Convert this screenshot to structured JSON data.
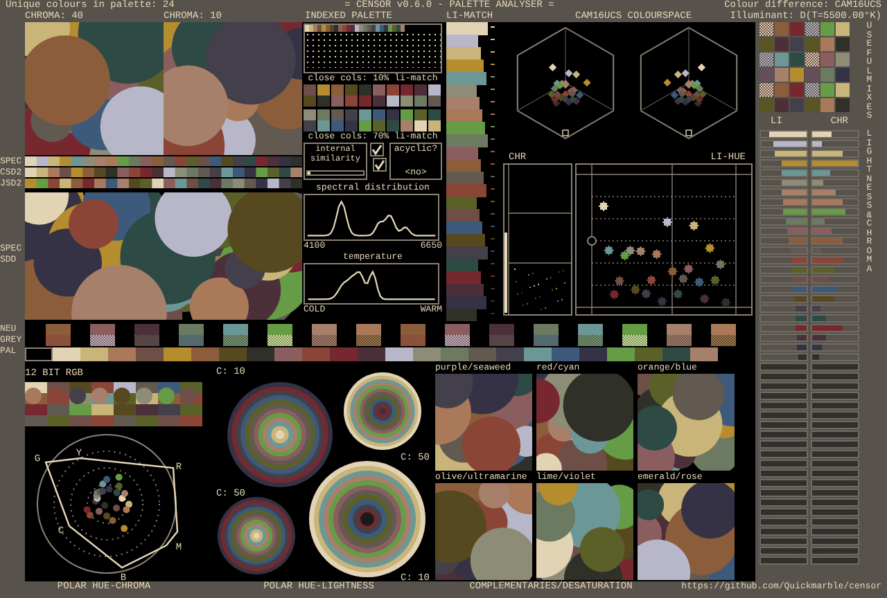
{
  "header": {
    "unique_colours": "Unique colours in palette: 24",
    "title": "= CENSOR v0.6.0 - PALETTE ANALYSER =",
    "colour_difference": "Colour difference: CAM16UCS",
    "illuminant": "Illuminant: D(T=5500.00°K)"
  },
  "palette": [
    {
      "color": "#e2d3b5"
    },
    {
      "color": "#c9b479"
    },
    {
      "color": "#a9795a"
    },
    {
      "color": "#6d4f47"
    },
    {
      "color": "#b58d2e"
    },
    {
      "color": "#8b5d3b"
    },
    {
      "color": "#57491f"
    },
    {
      "color": "#2f3129"
    },
    {
      "color": "#8a5e5f"
    },
    {
      "color": "#8b4537"
    },
    {
      "color": "#77282f"
    },
    {
      "color": "#4b3039"
    },
    {
      "color": "#b8b7c9"
    },
    {
      "color": "#8d8c77"
    },
    {
      "color": "#6b7a61"
    },
    {
      "color": "#625950"
    },
    {
      "color": "#433f4b"
    },
    {
      "color": "#6c9797"
    },
    {
      "color": "#3d5a7a"
    },
    {
      "color": "#343244"
    },
    {
      "color": "#659c45"
    },
    {
      "color": "#5b6029"
    },
    {
      "color": "#2e4a45"
    },
    {
      "color": "#a6806a"
    }
  ],
  "chroma_maps": [
    {
      "label": "CHROMA: 40"
    },
    {
      "label": "CHROMA: 10"
    }
  ],
  "row_labels": {
    "spec_bars": [
      "SPEC",
      "CSD2",
      "JSD2"
    ],
    "spec_map": [
      "SPEC",
      "SDD"
    ],
    "neutral": [
      "NEU",
      "GREY"
    ],
    "pal": "PAL"
  },
  "indexed_palette": {
    "title": "INDEXED PALETTE",
    "close_10": "close cols: 10% li-match",
    "close_70": "close cols: 70% li-match",
    "internal_similarity": {
      "label": "internal similarity",
      "checked": true,
      "level": 0.06
    },
    "acyclic": {
      "label": "acyclic?",
      "checked": true,
      "value": "<no>"
    },
    "spectral": {
      "title": "spectral distribution",
      "min": "4100",
      "max": "6650"
    },
    "temperature": {
      "title": "temperature",
      "min": "COLD",
      "max": "WARM"
    }
  },
  "li_match": {
    "title": "LI-MATCH"
  },
  "colourspace": {
    "title": "CAM16UCS COLOURSPACE",
    "chr": "CHR",
    "li_hue": "LI-HUE"
  },
  "right_panel": {
    "useful_mixes": "USEFUL MIXES",
    "li": "LI",
    "chr": "CHR",
    "lightness_chroma": "LIGHTNESS & CHROMA"
  },
  "rgb12": {
    "title": "12 BIT RGB"
  },
  "polar_chroma": {
    "hue_labels": [
      "G",
      "Y",
      "R",
      "C",
      "M",
      "B"
    ],
    "caption": "POLAR HUE-CHROMA"
  },
  "polar_lightness": {
    "discs": [
      {
        "label": "C: 10"
      },
      {
        "label": "C: 50"
      },
      {
        "label": "C: 50"
      },
      {
        "label": "C: 10"
      }
    ],
    "caption": "POLAR HUE-LIGHTNESS"
  },
  "complementaries": {
    "panels": [
      {
        "label": "purple/seaweed"
      },
      {
        "label": "red/cyan"
      },
      {
        "label": "orange/blue"
      },
      {
        "label": "olive/ultramarine"
      },
      {
        "label": "lime/violet"
      },
      {
        "label": "emerald/rose"
      }
    ],
    "caption": "COMPLEMENTARIES/DESATURATION"
  },
  "footer_url": "https://github.com/Quickmarble/censor"
}
